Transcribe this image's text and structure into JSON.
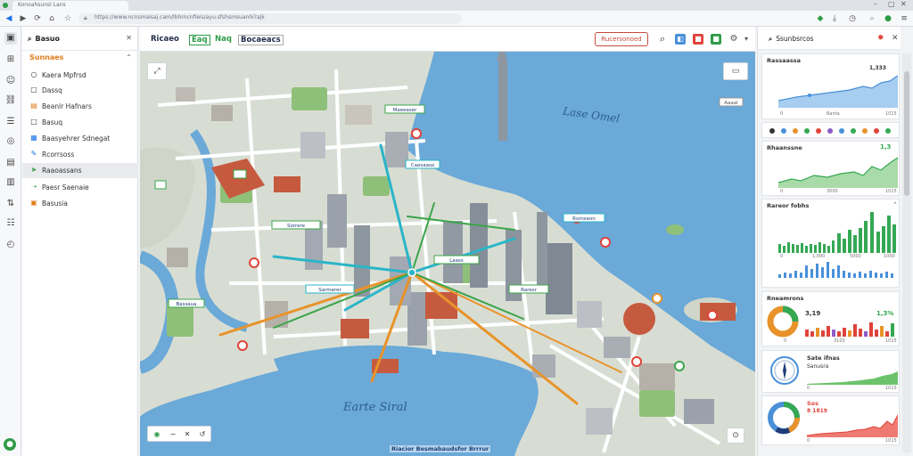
{
  "browser": {
    "tab_title": "Konoahsunsl Lans",
    "url": "https://www.ncnsmaisaj.cam/lbhrncnfieis/ayu.sfshsmsuanhi?ajk",
    "colors": {
      "tabbar": "#dfe3e8",
      "accent": "#2e9b48"
    }
  },
  "sidebar": {
    "title": "Basuo",
    "section": "Sunnaes",
    "items": [
      {
        "icon": "circle-icon",
        "label": "Kaera Mpfrsd"
      },
      {
        "icon": "square-icon",
        "label": "Dassq"
      },
      {
        "icon": "list-icon",
        "label": "Beanlr Hafnars"
      },
      {
        "icon": "box-icon",
        "label": "Basuq"
      },
      {
        "icon": "chart-icon",
        "label": "Baasyehrer Sdnegat"
      },
      {
        "icon": "edit-icon",
        "label": "Rcorrsoss"
      },
      {
        "icon": "route-icon",
        "label": "Raaoassans"
      },
      {
        "icon": "pin-icon",
        "label": "Paesr Saenaie"
      },
      {
        "icon": "file-icon",
        "label": "Basusia"
      }
    ]
  },
  "map": {
    "header": {
      "logo_a": "Ricaeo",
      "logo_b": "Eaq",
      "logo_c": "Naq",
      "logo_d": "Bocaeacs",
      "action_button": "Rucersonoed"
    },
    "lake_labels": [
      "Lase Omel",
      "Earte Siral"
    ],
    "attribution": "Riacior Besmabaudsfor Brrrur",
    "markers": [
      "Maeeaser",
      "Caesaaso",
      "Sorrere",
      "Rsmeeon",
      "Laass",
      "Sarmerer",
      "Raresr",
      "Bassaua",
      "Aaaal"
    ],
    "colors": {
      "water": "#6aa9d8",
      "land": "#d6dcd2",
      "route_green": "#3aa54a",
      "route_orange": "#e8932a",
      "route_teal": "#2ab5c8"
    }
  },
  "right_panel": {
    "title": "Ssunbsrcos",
    "cards": [
      {
        "title": "Rassaassa",
        "value": "1,333",
        "axis": [
          "0",
          "Banta",
          "1015"
        ]
      },
      {
        "title": "Rhaanssne",
        "value": "1,3",
        "axis": [
          "0",
          "3000",
          "1015"
        ]
      },
      {
        "title": "Rareor fobhs",
        "value": "",
        "axis": [
          "0",
          "1,000",
          "5000",
          "1000"
        ]
      },
      {
        "title": "Rneamrons",
        "value": "3,19",
        "value2": "1,3%",
        "axis": [
          "0",
          "3103",
          "1015"
        ]
      },
      {
        "title": "Sate ifnas",
        "value": "Sanusra",
        "axis": [
          "0",
          "1015"
        ]
      },
      {
        "title": "Sos",
        "value": "8 1819",
        "axis": [
          "0",
          "1015"
        ]
      }
    ],
    "colors": {
      "blue": "#4a90d9",
      "green": "#34a853",
      "red": "#e0433a",
      "orange": "#e8932a",
      "purple": "#8e5cc9"
    }
  }
}
